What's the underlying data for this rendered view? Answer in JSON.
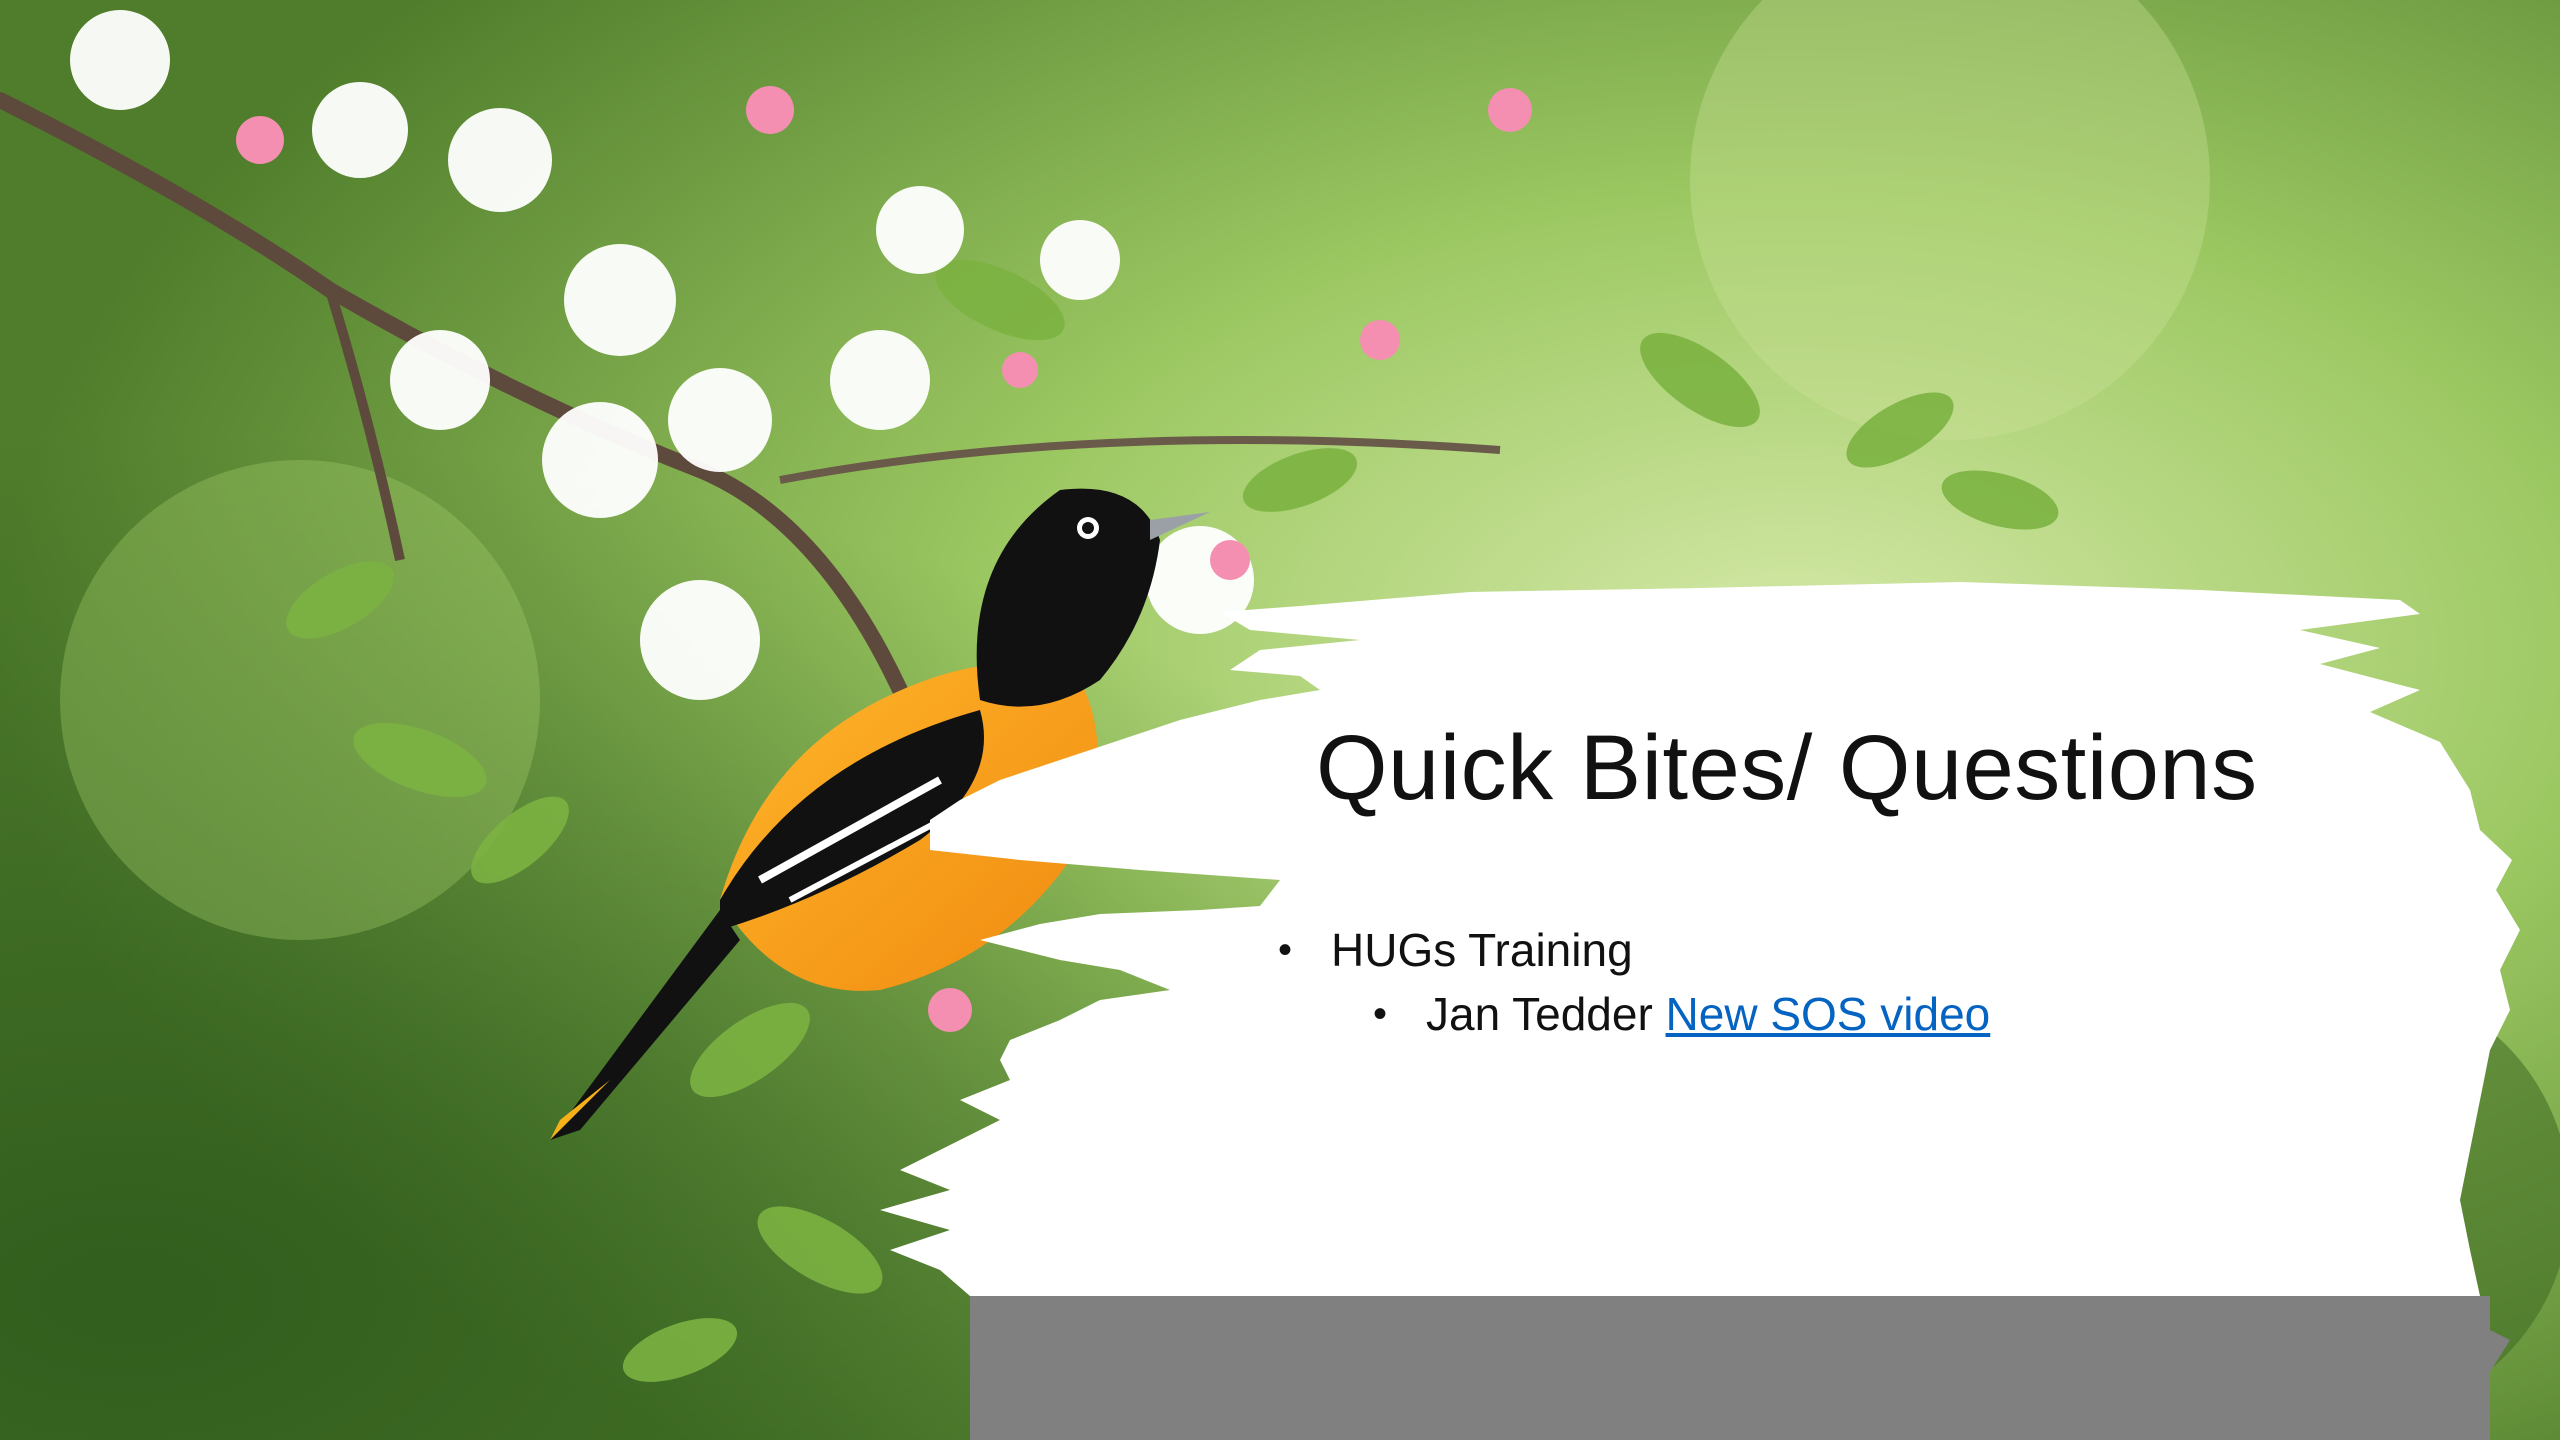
{
  "slide": {
    "title": "Quick Bites/ Questions",
    "bullets": [
      {
        "text": "HUGs Training"
      }
    ],
    "sub_bullet": {
      "text": "Jan Tedder",
      "link_text": "New SOS video"
    }
  },
  "colors": {
    "background_green": "#8fbe5a",
    "card_white": "#ffffff",
    "footer_bar_gray": "#808080",
    "link_blue": "#0563c1"
  },
  "icons": {
    "bullet": "bullet-dot-icon"
  }
}
